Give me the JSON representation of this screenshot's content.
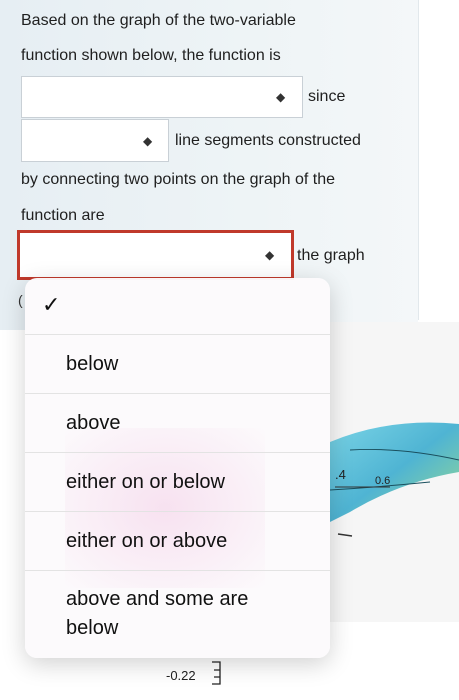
{
  "question": {
    "line1": "Based on the graph of the two-variable",
    "line2": "function shown below, the function is",
    "since": "since",
    "segments": "line segments constructed",
    "line5": "by connecting two points on the graph of the",
    "line6": "function are",
    "the_graph": "the graph",
    "cutoff_char": "("
  },
  "dropdown": {
    "checkmark": "✓",
    "options": [
      "below",
      "above",
      "either on or below",
      "either on or above",
      "above and some are below"
    ]
  },
  "graph": {
    "tick_a": ".4",
    "tick_b": "0.6",
    "tick_c": "-0.22"
  },
  "colors": {
    "active_border": "#c0392b",
    "surface": "#5fc3d8"
  },
  "icons": {
    "select_arrows": "up-down-arrows-icon",
    "check": "checkmark-icon"
  }
}
